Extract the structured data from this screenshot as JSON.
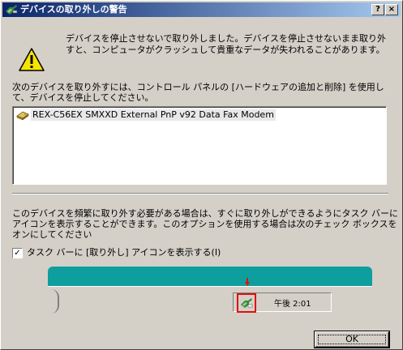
{
  "window": {
    "title": "デバイスの取り外しの警告",
    "help_label": "?",
    "close_label": "×"
  },
  "icons": {
    "title": "hardware-eject-icon",
    "warning": "warning-triangle-icon",
    "device": "modem-icon",
    "tray": "hardware-eject-tray-icon",
    "arrow": "down-arrow-indicator-icon"
  },
  "warning": {
    "message": "デバイスを停止させないで取り外しました。デバイスを停止させないまま取り外すと、コンピュータがクラッシュして貴重なデータが失われることがあります。"
  },
  "instructions": "次のデバイスを取り外すには、コントロール パネルの [ハードウェアの追加と削除] を使用して、デバイスを停止してください。",
  "device_list": {
    "items": [
      {
        "label": "REX-C56EX SMXXD External PnP v92 Data Fax Modem"
      }
    ]
  },
  "hint": "このデバイスを頻繁に取り外す必要がある場合は、すぐに取り外しができるようにタスク バーにアイコンを表示することができます。このオプションを使用する場合は次のチェック ボックスをオンにしてください",
  "checkbox": {
    "label": "タスク バーに [取り外し] アイコンを表示する(I)",
    "checked": true,
    "check_mark": "✓"
  },
  "taskbar_preview": {
    "clock": "午後 2:01",
    "highlight_color": "#e01010",
    "desktop_color": "#0e9e9e"
  },
  "buttons": {
    "ok_label": "OK"
  }
}
